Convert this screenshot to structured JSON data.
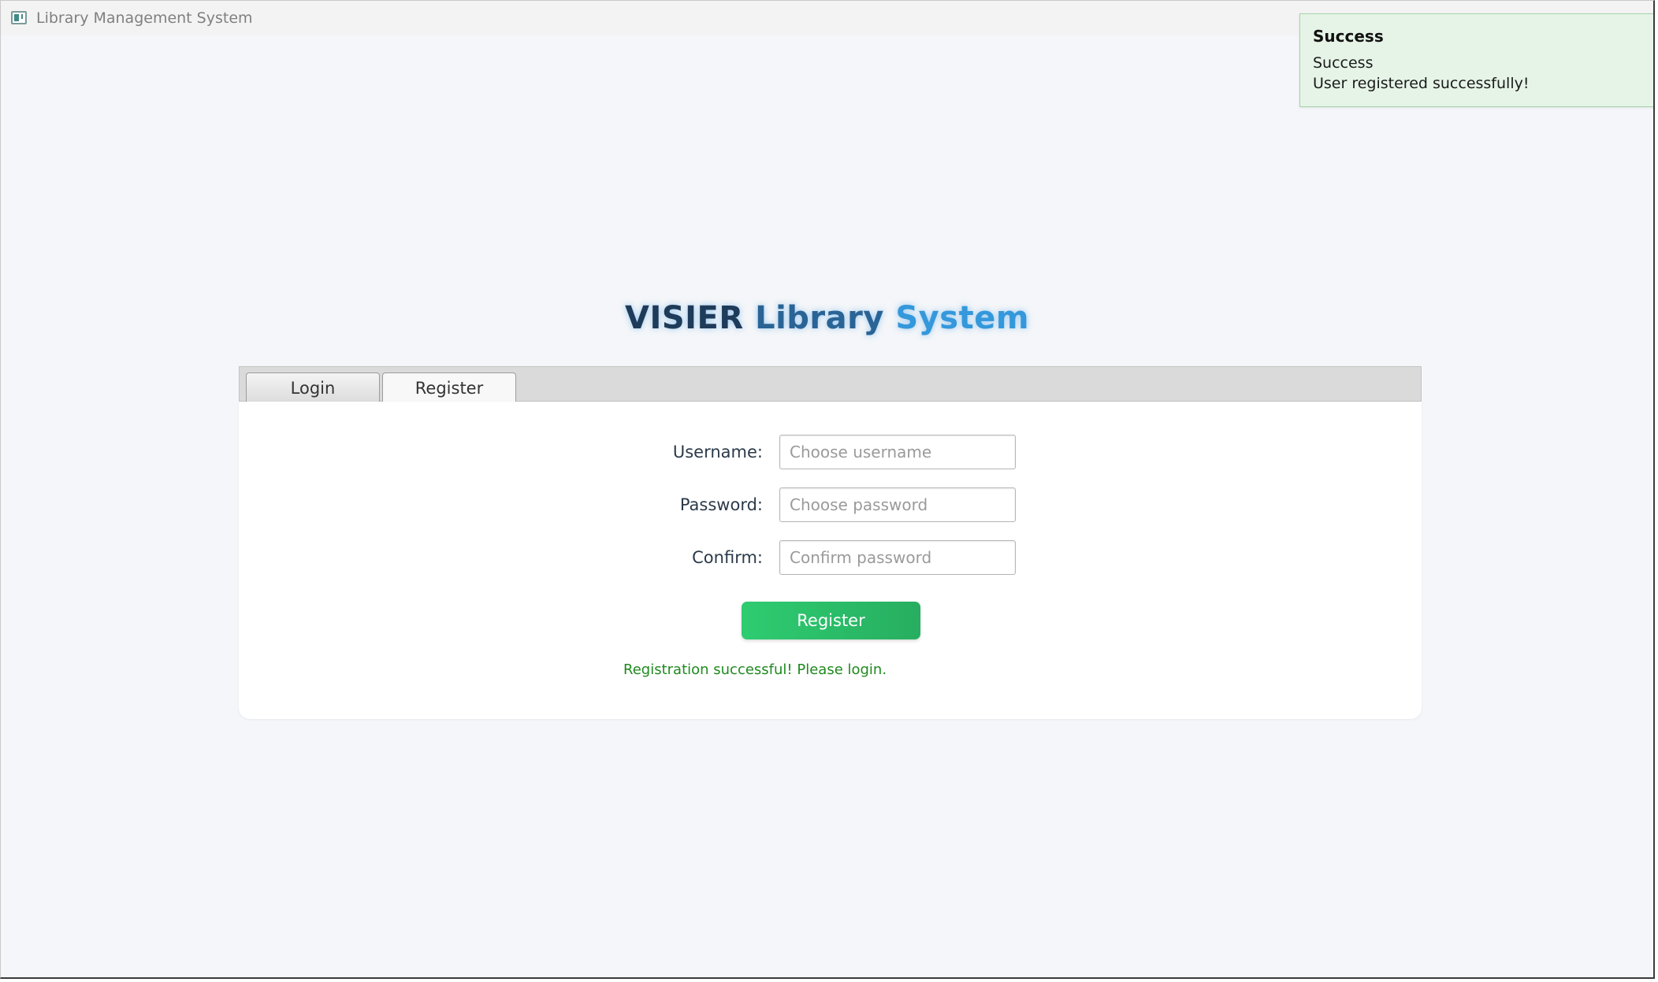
{
  "window": {
    "title": "Library Management System"
  },
  "toast": {
    "title": "Success",
    "header": "Success",
    "message": "User registered successfully!",
    "color": "#e6f4e7"
  },
  "brand": {
    "word1": "VISIER",
    "word2": "Library",
    "word3": "System"
  },
  "tabs": [
    {
      "label": "Login",
      "selected": false
    },
    {
      "label": "Register",
      "selected": true
    }
  ],
  "form": {
    "username_label": "Username:",
    "username_placeholder": "Choose username",
    "username_value": "",
    "password_label": "Password:",
    "password_placeholder": "Choose password",
    "password_value": "",
    "confirm_label": "Confirm:",
    "confirm_placeholder": "Confirm password",
    "confirm_value": "",
    "submit_label": "Register",
    "status_message": "Registration successful! Please login."
  },
  "colors": {
    "accent_green": "#2ecc71",
    "success_text": "#1e8a1e",
    "brand_dark": "#1f3b5a",
    "brand_light": "#3498db"
  }
}
